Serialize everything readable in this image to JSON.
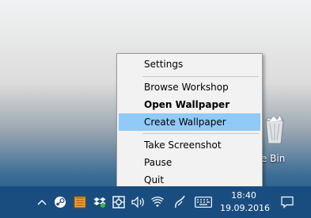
{
  "desktop": {
    "recycle_bin_label": "cle Bin"
  },
  "context_menu": {
    "items": [
      {
        "label": "Settings"
      },
      {
        "label": "Browse Workshop"
      },
      {
        "label": "Open Wallpaper",
        "bold": true
      },
      {
        "label": "Create Wallpaper",
        "highlighted": true
      },
      {
        "label": "Take Screenshot"
      },
      {
        "label": "Pause"
      },
      {
        "label": "Quit"
      }
    ],
    "highlight_color": "#91c9f7"
  },
  "taskbar": {
    "color": "#1a4d7f",
    "clock": {
      "time": "18:40",
      "date": "19.09.2016"
    },
    "tray_icons": [
      "chevron-up-icon",
      "steam-icon",
      "wallpaper-engine-icon",
      "dropbox-icon",
      "app-icon",
      "volume-icon",
      "wifi-icon",
      "pen-icon",
      "keyboard-icon"
    ],
    "notification_icon": "notification-icon"
  }
}
